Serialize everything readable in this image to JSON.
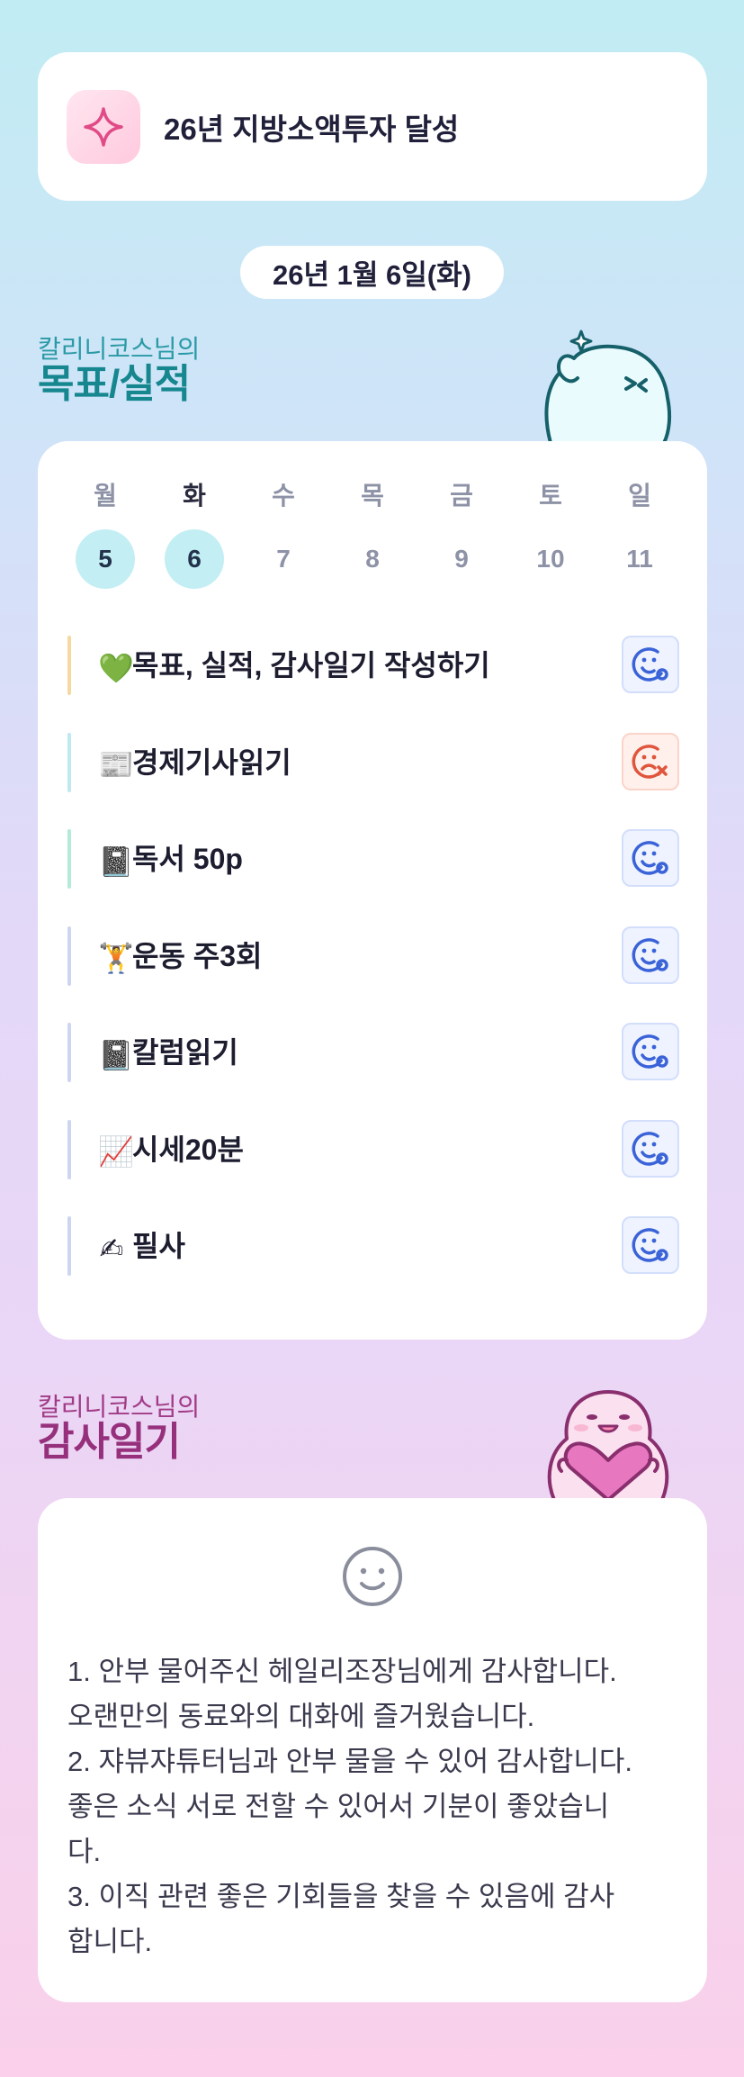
{
  "goal": {
    "title": "26년 지방소액투자 달성",
    "icon": "sparkle-icon"
  },
  "date_label": "26년 1월 6일(화)",
  "goals_section": {
    "subtitle": "칼리니코스님의",
    "title": "목표/실적"
  },
  "week": [
    {
      "name": "월",
      "num": "5",
      "done": true,
      "current": false
    },
    {
      "name": "화",
      "num": "6",
      "done": true,
      "current": true
    },
    {
      "name": "수",
      "num": "7",
      "done": false,
      "current": false
    },
    {
      "name": "목",
      "num": "8",
      "done": false,
      "current": false
    },
    {
      "name": "금",
      "num": "9",
      "done": false,
      "current": false
    },
    {
      "name": "토",
      "num": "10",
      "done": false,
      "current": false
    },
    {
      "name": "일",
      "num": "11",
      "done": false,
      "current": false
    }
  ],
  "tasks": [
    {
      "emoji": "💚",
      "label": "목표, 실적, 감사일기 작성하기",
      "status": "done",
      "bar_color": "#f6d9a0"
    },
    {
      "emoji": "📰",
      "label": "경제기사읽기",
      "status": "failed",
      "bar_color": "#bde9ef"
    },
    {
      "emoji": "📓",
      "label": "독서 50p",
      "status": "done",
      "bar_color": "#b4ead6"
    },
    {
      "emoji": "🏋",
      "label": "운동 주3회",
      "status": "done",
      "bar_color": "#cdd6f0"
    },
    {
      "emoji": "📓",
      "label": "칼럼읽기",
      "status": "done",
      "bar_color": "#cdd6f0"
    },
    {
      "emoji": "📈",
      "label": "시세20분",
      "status": "done",
      "bar_color": "#cdd6f0"
    },
    {
      "emoji": "✍",
      "label": "필사",
      "status": "done",
      "bar_color": "#cdd6f0"
    }
  ],
  "gratitude_section": {
    "subtitle": "칼리니코스님의",
    "title": "감사일기"
  },
  "gratitude": {
    "mood_icon": "smile-face-icon",
    "text": "1. 안부 물어주신 헤일리조장님에게 감사합니다.\n오랜만의 동료와의 대화에 즐거웠습니다.\n2. 쟈뷰쟈튜터님과 안부 물을 수 있어 감사합니다.\n좋은 소식 서로 전할 수 있어서 기분이 좋았습니\n다.\n3. 이직 관련 좋은 기회들을 찾을 수 있음에 감사\n합니다."
  },
  "colors": {
    "accent_teal": "#16868f",
    "accent_pink": "#96307c",
    "status_ok": "#3a63d8",
    "status_fail": "#e0553c"
  }
}
